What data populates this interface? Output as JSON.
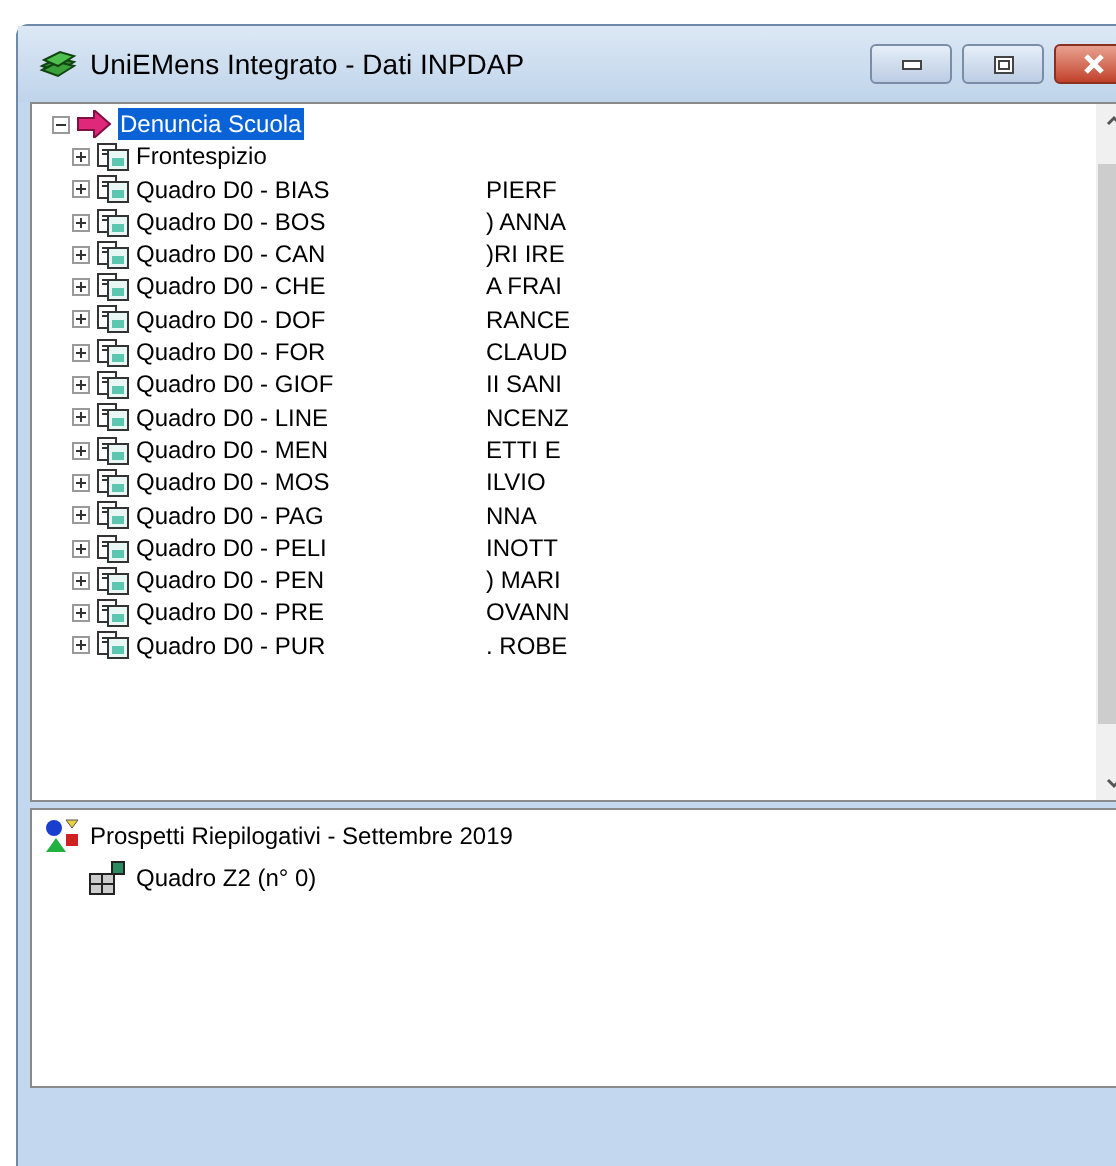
{
  "window": {
    "title": "UniEMens Integrato - Dati INPDAP"
  },
  "tree": {
    "label": "Denuncia Scuola",
    "selected": true,
    "expanded": true,
    "children": [
      {
        "label": "Frontespizio",
        "expanded": false
      },
      {
        "label": "Quadro D0 - BIAS",
        "column_2": "PIERF",
        "expanded": false
      },
      {
        "label": "Quadro D0 - BOS",
        "column_2": ") ANNA",
        "expanded": false
      },
      {
        "label": "Quadro D0 - CAN",
        "column_2": ")RI IRE",
        "expanded": false
      },
      {
        "label": "Quadro D0 - CHE",
        "column_2": "A FRAI",
        "expanded": false
      },
      {
        "label": "Quadro D0 - DOF",
        "column_2": "RANCE",
        "expanded": false
      },
      {
        "label": "Quadro D0 - FOR",
        "column_2": "CLAUD",
        "expanded": false
      },
      {
        "label": "Quadro D0 - GIOF",
        "column_2": "II SANI",
        "expanded": false
      },
      {
        "label": "Quadro D0 - LINE",
        "column_2": "NCENZ",
        "expanded": false
      },
      {
        "label": "Quadro D0 - MEN",
        "column_2": "ETTI E",
        "expanded": false
      },
      {
        "label": "Quadro D0 - MOS",
        "column_2": "ILVIO",
        "expanded": false
      },
      {
        "label": "Quadro D0 - PAG",
        "column_2": "NNA",
        "expanded": false
      },
      {
        "label": "Quadro D0 - PELI",
        "column_2": "INOTT",
        "expanded": false
      },
      {
        "label": "Quadro D0 - PEN",
        "column_2": ") MARI",
        "expanded": false
      },
      {
        "label": "Quadro D0 - PRE",
        "column_2": "OVANN",
        "expanded": false
      },
      {
        "label": "Quadro D0 - PUR",
        "column_2": ". ROBE",
        "expanded": false
      }
    ]
  },
  "summary": {
    "label": "Prospetti Riepilogativi - Settembre 2019",
    "children": [
      {
        "label": "Quadro Z2 (n° 0)"
      }
    ]
  }
}
